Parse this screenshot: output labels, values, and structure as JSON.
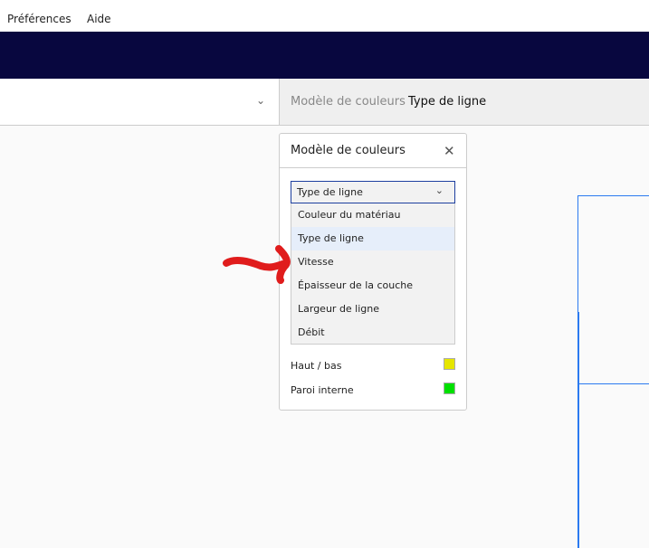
{
  "menubar": {
    "items": [
      "Préférences",
      "Aide"
    ]
  },
  "toolbar": {
    "color_scheme_label": "Modèle de couleurs",
    "color_scheme_value": "Type de ligne"
  },
  "panel": {
    "title": "Modèle de couleurs",
    "select_value": "Type de ligne",
    "options": [
      "Couleur du matériau",
      "Type de ligne",
      "Vitesse",
      "Épaisseur de la couche",
      "Largeur de ligne",
      "Débit"
    ],
    "selected_option": "Type de ligne",
    "legend": [
      {
        "label": "Haut / bas",
        "color": "#e6e600"
      },
      {
        "label": "Paroi interne",
        "color": "#00e000"
      }
    ]
  },
  "annotation": {
    "color": "#e01c1c",
    "points_to": "Vitesse"
  }
}
